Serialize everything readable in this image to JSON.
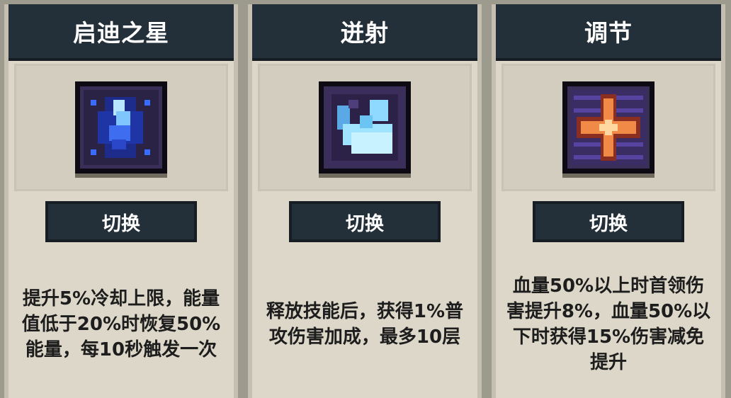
{
  "cards": [
    {
      "title": "启迪之星",
      "icon": "blue-crystal-star-icon",
      "button_label": "切换",
      "description": "提升5%冷却上限，能量值低于20%时恢复50%能量，每10秒触发一次"
    },
    {
      "title": "迸射",
      "icon": "cyan-shard-burst-icon",
      "button_label": "切换",
      "description": "释放技能后，获得1%普攻伤害加成，最多10层"
    },
    {
      "title": "调节",
      "icon": "orange-cross-icon",
      "button_label": "切换",
      "description": "血量50%以上时首领伤害提升8%，血量50%以下时获得15%伤害减免提升"
    }
  ],
  "colors": {
    "header_bg": "#243039",
    "card_bg": "#dcd7c8",
    "page_bg": "#9d9a8e"
  }
}
